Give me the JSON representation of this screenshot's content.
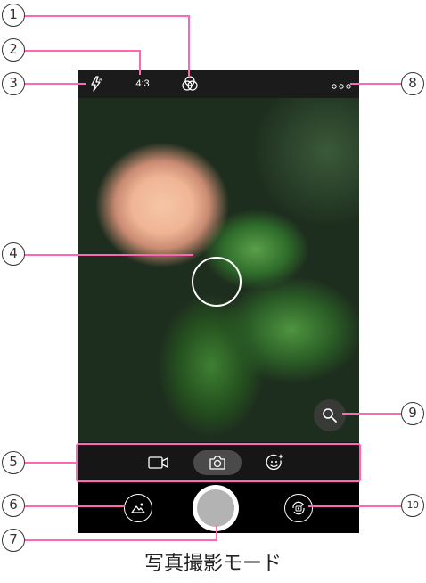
{
  "top_bar": {
    "flash_icon": "flash-auto-icon",
    "aspect_ratio": "4:3",
    "filter_icon": "color-filter-icon",
    "more_icon": "more-options-icon"
  },
  "viewfinder": {
    "focus_icon": "focus-ring",
    "zoom_icon": "magnifier-icon"
  },
  "mode_bar": {
    "modes": [
      {
        "id": "video",
        "icon": "video-camera-icon"
      },
      {
        "id": "photo",
        "icon": "camera-icon",
        "selected": true
      },
      {
        "id": "beauty",
        "icon": "face-sparkle-icon"
      }
    ]
  },
  "bottom_bar": {
    "gallery_icon": "gallery-icon",
    "shutter_icon": "shutter-button",
    "switch_icon": "switch-camera-icon"
  },
  "callouts": [
    "1",
    "2",
    "3",
    "4",
    "5",
    "6",
    "7",
    "8",
    "9",
    "10"
  ],
  "caption": "写真撮影モード",
  "colors": {
    "callout_line": "#ff66b3",
    "mode_selected_bg": "#4a4a4a",
    "shutter_inner": "#b3b3b3"
  }
}
